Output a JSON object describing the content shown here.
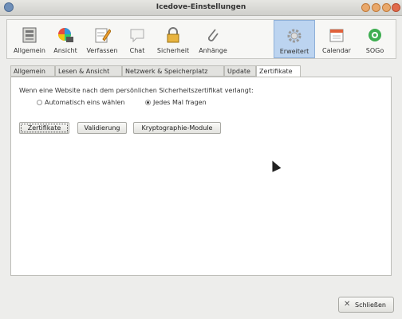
{
  "window": {
    "title": "Icedove-Einstellungen"
  },
  "toolbar": {
    "items": [
      {
        "label": "Allgemein",
        "icon": "general-icon"
      },
      {
        "label": "Ansicht",
        "icon": "display-icon"
      },
      {
        "label": "Verfassen",
        "icon": "compose-icon"
      },
      {
        "label": "Chat",
        "icon": "chat-icon"
      },
      {
        "label": "Sicherheit",
        "icon": "lock-icon"
      },
      {
        "label": "Anhänge",
        "icon": "paperclip-icon"
      },
      {
        "label": "Erweitert",
        "icon": "gear-icon",
        "active": true
      },
      {
        "label": "Calendar",
        "icon": "calendar-icon"
      },
      {
        "label": "SOGo",
        "icon": "sogo-icon"
      }
    ]
  },
  "tabs": [
    {
      "label": "Allgemein"
    },
    {
      "label": "Lesen & Ansicht"
    },
    {
      "label": "Netzwerk & Speicherplatz"
    },
    {
      "label": "Update"
    },
    {
      "label": "Zertifikate",
      "active": true
    }
  ],
  "certificates": {
    "prompt": "Wenn eine Website nach dem persönlichen Sicherheitszertifikat verlangt:",
    "radio_auto": "Automatisch eins wählen",
    "radio_ask": "Jedes Mal fragen",
    "selected": "radio_ask",
    "buttons": {
      "certificates": "Zertifikate",
      "validation": "Validierung",
      "crypto": "Kryptographie-Module"
    }
  },
  "footer": {
    "close": "Schließen"
  }
}
